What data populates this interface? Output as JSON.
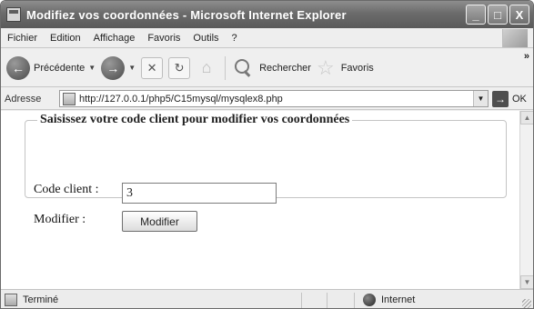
{
  "window": {
    "title": "Modifiez vos coordonnées - Microsoft Internet Explorer",
    "buttons": [
      "_",
      "□",
      "X"
    ]
  },
  "menu": [
    "Fichier",
    "Edition",
    "Affichage",
    "Favoris",
    "Outils",
    "?"
  ],
  "toolbar": {
    "back_label": "Précédente",
    "search_label": "Rechercher",
    "favorites_label": "Favoris",
    "more": "»"
  },
  "address": {
    "label": "Adresse",
    "url": "http://127.0.0.1/php5/C15mysql/mysqlex8.php",
    "go_label": "OK"
  },
  "form": {
    "legend": "Saisissez votre code client pour modifier vos coordonnées",
    "code_label": "Code client :",
    "code_value": "3",
    "modifier_label": "Modifier :",
    "modifier_button": "Modifier"
  },
  "status": {
    "text": "Terminé",
    "zone": "Internet"
  }
}
